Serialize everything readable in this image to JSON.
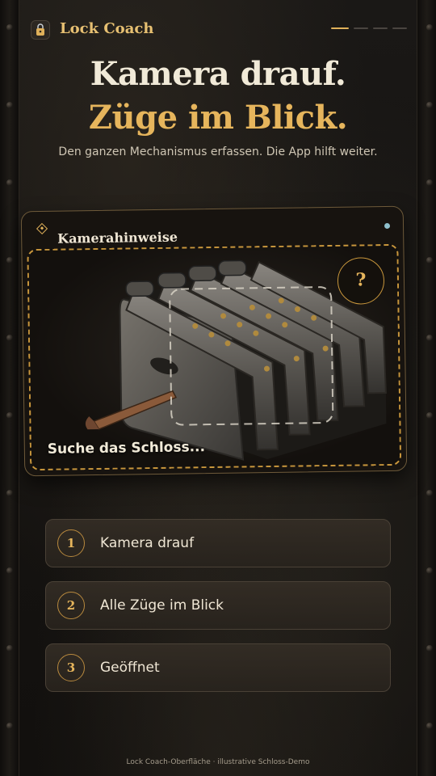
{
  "app": {
    "name": "Lock Coach",
    "icon": "lock-icon"
  },
  "progress": {
    "current_step": 1,
    "total_steps": 4
  },
  "hero": {
    "line1": "Kamera drauf.",
    "line2": "Züge im Blick.",
    "subtitle": "Den ganzen Mechanismus erfassen. Die App hilft weiter."
  },
  "camera_card": {
    "title": "Kamerahinweise",
    "help_label": "?",
    "status_text": "Suche das Schloss..."
  },
  "steps": [
    {
      "number": "1",
      "label": "Kamera drauf"
    },
    {
      "number": "2",
      "label": "Alle Züge im Blick"
    },
    {
      "number": "3",
      "label": "Geöffnet"
    }
  ],
  "footer": "Lock Coach-Oberfläche · illustrative Schloss-Demo",
  "colors": {
    "accent_gold": "#e6b55c",
    "text_primary": "#f1ead8",
    "background": "#151311",
    "live_indicator": "#8fc0cc"
  }
}
